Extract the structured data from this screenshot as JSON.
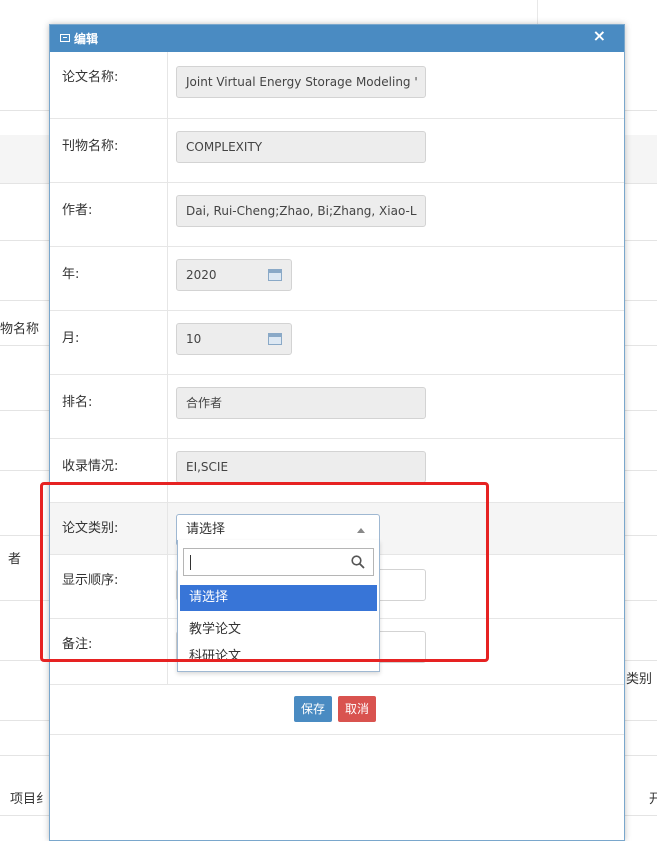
{
  "background": {
    "label_journal_name": "物名称",
    "label_author": "者",
    "label_category": "类别",
    "label_project": "项目纟",
    "label_right_edge": "开"
  },
  "modal": {
    "title": "编辑",
    "close_symbol": "×",
    "fields": {
      "paper_name": {
        "label": "论文名称:",
        "value": "Joint Virtual Energy Storage Modeling '"
      },
      "journal_name": {
        "label": "刊物名称:",
        "value": "COMPLEXITY"
      },
      "authors": {
        "label": "作者:",
        "value": "Dai, Rui-Cheng;Zhao, Bi;Zhang, Xiao-L"
      },
      "year": {
        "label": "年:",
        "value": "2020"
      },
      "month": {
        "label": "月:",
        "value": "10"
      },
      "ranking": {
        "label": "排名:",
        "value": "合作者"
      },
      "indexing": {
        "label": "收录情况:",
        "value": "EI,SCIE"
      },
      "category": {
        "label": "论文类别:",
        "value": "请选择"
      },
      "display_order": {
        "label": "显示顺序:"
      },
      "remark": {
        "label": "备注:"
      }
    },
    "dropdown": {
      "search_value": "",
      "options": [
        "请选择",
        "教学论文",
        "科研论文"
      ],
      "selected_index": 0
    },
    "buttons": {
      "save": "保存",
      "cancel": "取消"
    }
  },
  "colors": {
    "header": "#4a8bc2",
    "cancel": "#d9534f",
    "highlight": "#e62222",
    "selected_option": "#3875d7"
  }
}
